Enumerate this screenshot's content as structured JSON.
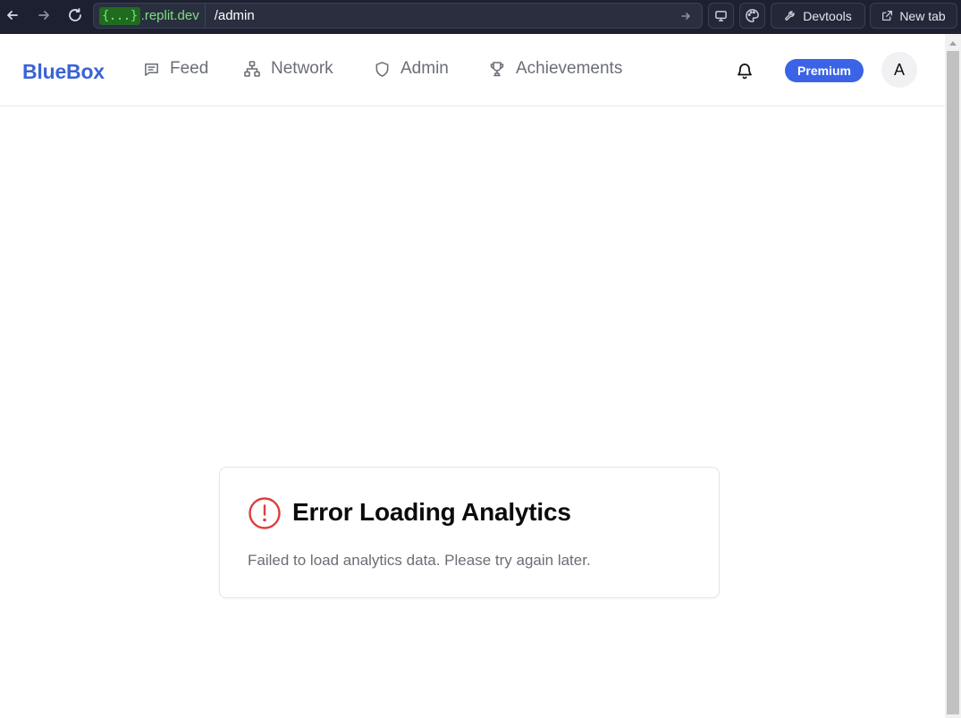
{
  "browser": {
    "url_badge": "{...}",
    "url_domain": ".replit.dev",
    "url_path": "/admin",
    "devtools_label": "Devtools",
    "new_tab_label": "New tab"
  },
  "header": {
    "logo": "BlueBox",
    "nav": [
      {
        "label": "Feed",
        "icon": "message-square-icon"
      },
      {
        "label": "Network",
        "icon": "network-icon"
      },
      {
        "label": "Admin",
        "icon": "shield-icon"
      },
      {
        "label": "Achievements",
        "icon": "trophy-icon"
      }
    ],
    "premium_label": "Premium",
    "avatar_initial": "A"
  },
  "error": {
    "title": "Error Loading Analytics",
    "message": "Failed to load analytics data. Please try again later.",
    "icon": "alert-circle-icon",
    "icon_color": "#dc3d3d"
  },
  "colors": {
    "brand": "#3b63d6",
    "premium_bg": "#3b63e6",
    "chrome_bg": "#1c2030"
  }
}
